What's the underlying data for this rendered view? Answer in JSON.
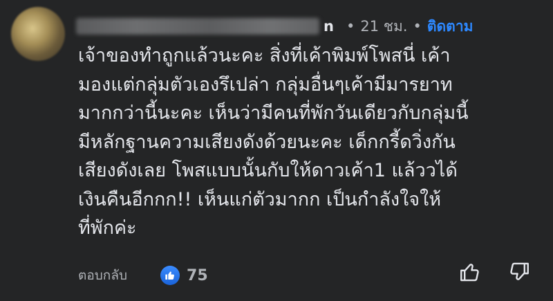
{
  "comment": {
    "author_visible_suffix": "n",
    "time": "21 ชม.",
    "separator": "•",
    "follow_label": "ติดตาม",
    "text_lines": [
      "เจ้าของทำถูกแล้วนะคะ สิ่งที่เค้าพิมพ์โพสนี่ เค้า",
      "มองแต่กลุ่มตัวเองรึเปล่า กลุ่มอื่นๆเค้ามีมารยาท",
      "มากกว่านี้นะคะ เห็นว่ามีคนที่พักวันเดียวกับกลุ่มนี้",
      "มีหลักฐานความเสียงดังด้วยนะคะ  เด็กกรี้ดวิ่งกัน",
      "เสียงดังเลย โพสแบบนั้นกับให้ดาวเค้า1 แล้ววได้",
      "เงินคืนอีกกก!!  เห็นแก่ตัวมากก เป็นกำลังใจให้",
      "ที่พักค่ะ"
    ],
    "reply_label": "ตอบกลับ",
    "like_count": "75"
  },
  "icons": {
    "like_badge": "thumbs-up-icon",
    "upvote": "thumbs-up-outline-icon",
    "downvote": "thumbs-down-outline-icon"
  },
  "colors": {
    "background": "#242526",
    "text": "#e4e6eb",
    "secondary": "#b0b3b8",
    "accent": "#2d88ff"
  }
}
